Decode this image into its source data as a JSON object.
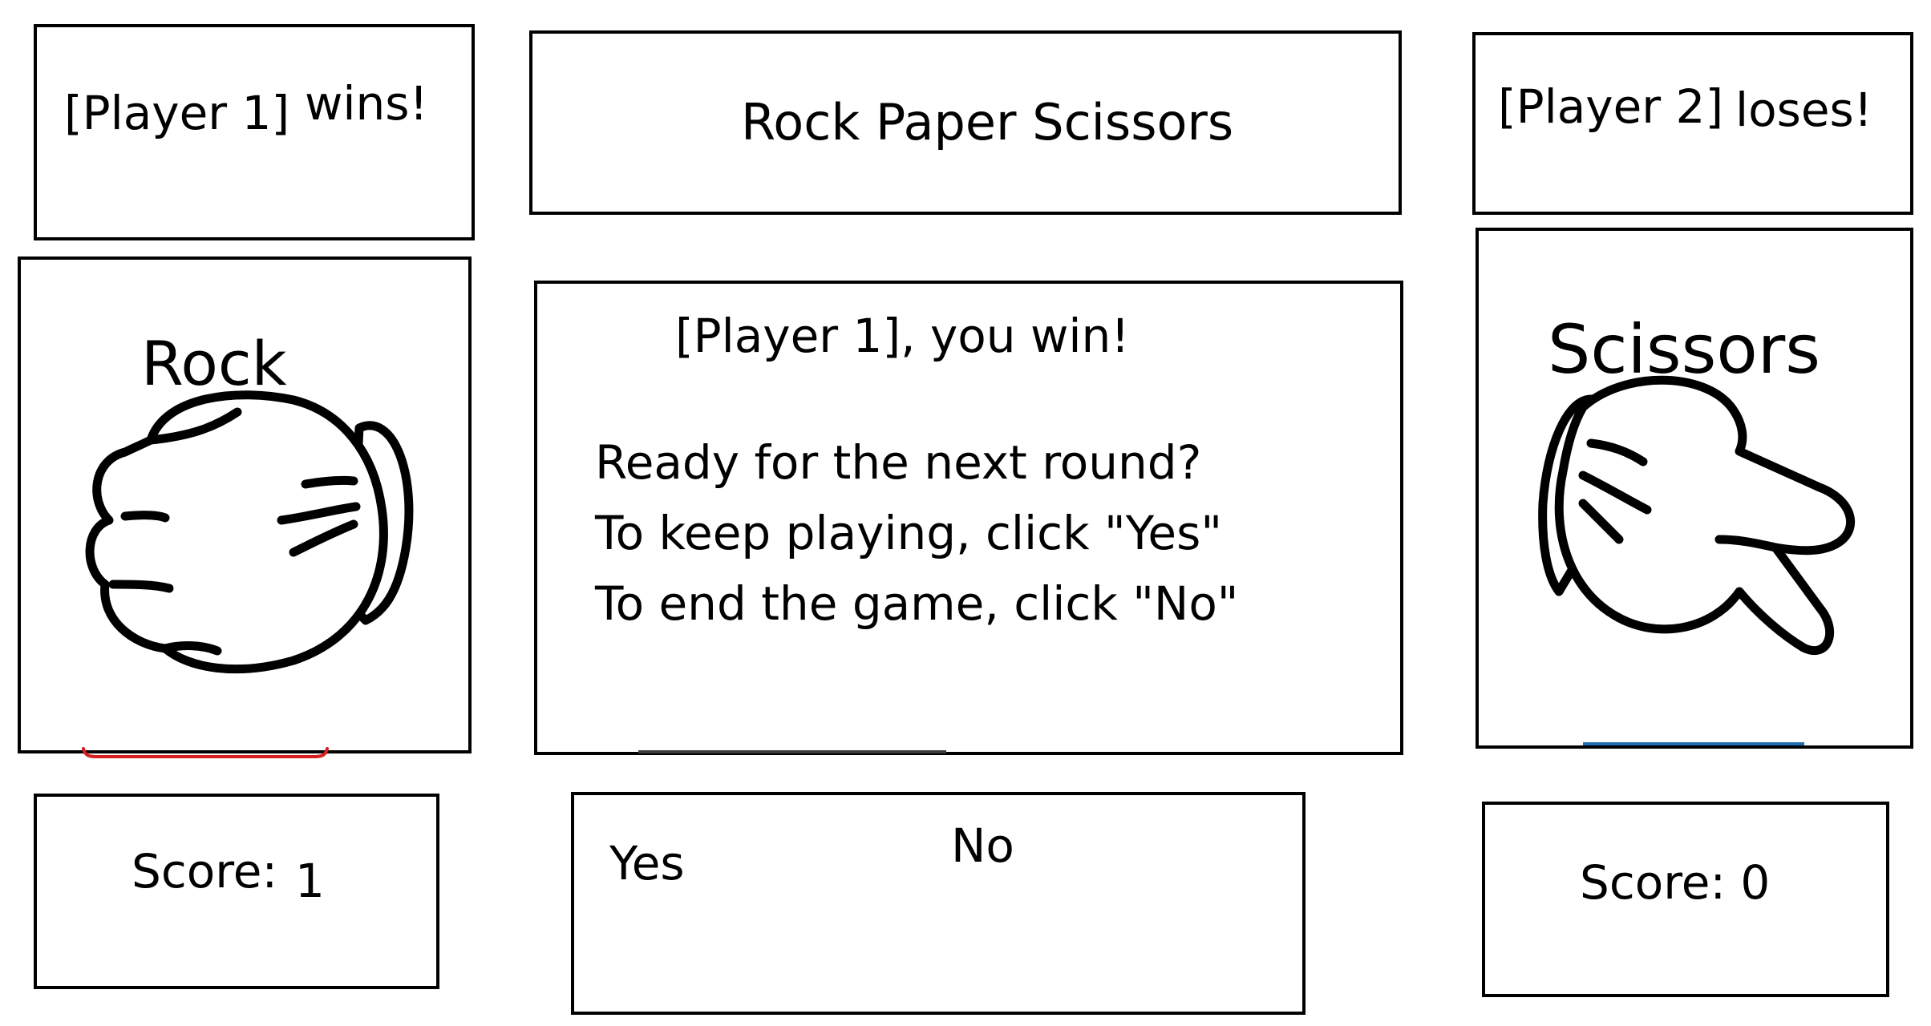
{
  "header": {
    "player1_status": "[Player 1]",
    "player1_status_suffix": "wins!",
    "title": "Rock Paper Scissors",
    "player2_status": "[Player 2]",
    "player2_status_suffix": "loses!"
  },
  "player1": {
    "choice_label": "Rock",
    "choice_icon": "rock-fist-icon",
    "score_label": "Score:",
    "score_value": "1"
  },
  "player2": {
    "choice_label": "Scissors",
    "choice_icon": "scissors-hand-icon",
    "score_label": "Score: 0"
  },
  "message": {
    "headline": "[Player 1], you win!",
    "line1": "Ready for the next round?",
    "line2": "To keep playing, click \"Yes\"",
    "line3": "To end the game, click \"No\""
  },
  "actions": {
    "yes_label": "Yes",
    "no_label": "No"
  },
  "colors": {
    "stroke": "#000000",
    "squiggle": "#d81e1e",
    "accent_line": "#1f6fb5"
  }
}
